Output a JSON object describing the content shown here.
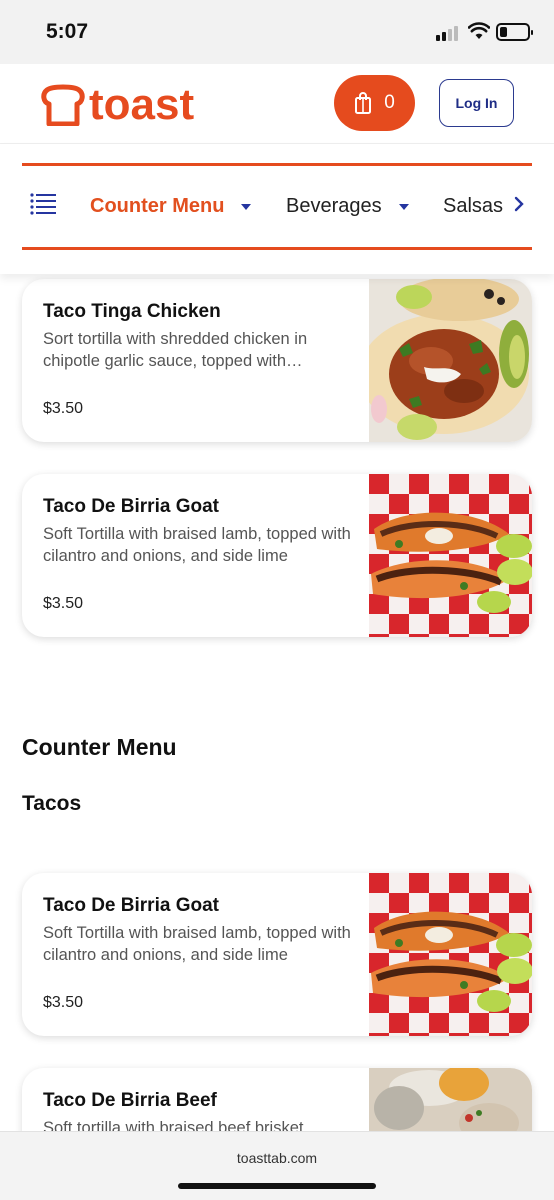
{
  "status_bar": {
    "time": "5:07"
  },
  "header": {
    "brand": "toast",
    "cart_count": "0",
    "login_label": "Log In"
  },
  "nav": {
    "tabs": [
      {
        "label": "Counter Menu",
        "active": true
      },
      {
        "label": "Beverages",
        "active": false
      },
      {
        "label": "Salsas",
        "active": false
      }
    ]
  },
  "items_top": [
    {
      "name": "Taco Tinga Chicken",
      "description": "Sort tortilla with shredded chicken in chipotle garlic sauce, topped with…",
      "price": "$3.50"
    },
    {
      "name": "Taco De Birria Goat",
      "description": "Soft Tortilla with braised lamb, topped with cilantro and onions, and side lime",
      "price": "$3.50"
    }
  ],
  "section": {
    "title": "Counter Menu",
    "subtitle": "Tacos"
  },
  "items_tacos": [
    {
      "name": "Taco De Birria Goat",
      "description": "Soft Tortilla with braised lamb, topped with cilantro and onions, and side lime",
      "price": "$3.50"
    },
    {
      "name": "Taco De Birria Beef",
      "description": "Soft tortilla with braised beef brisket",
      "price": ""
    }
  ],
  "browser": {
    "url": "toasttab.com"
  },
  "colors": {
    "brand": "#e54b1e",
    "link": "#1f2d86"
  }
}
